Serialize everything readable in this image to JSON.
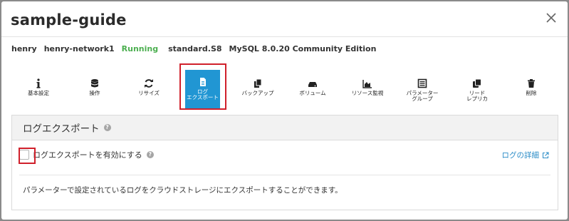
{
  "dialog": {
    "title": "sample-guide"
  },
  "info": {
    "user": "henry",
    "network": "henry-network1",
    "status": "Running",
    "plan": "standard.S8",
    "engine": "MySQL 8.0.20 Community Edition",
    "status_color": "#4caf50"
  },
  "toolbar": {
    "items": [
      {
        "label": "基本設定",
        "icon": "info-icon"
      },
      {
        "label": "操作",
        "icon": "database-icon"
      },
      {
        "label": "リサイズ",
        "icon": "sync-icon"
      },
      {
        "label": "ログ\nエクスポート",
        "icon": "file-icon",
        "active": true
      },
      {
        "label": "バックアップ",
        "icon": "copy-icon"
      },
      {
        "label": "ボリューム",
        "icon": "drive-icon"
      },
      {
        "label": "リソース監視",
        "icon": "area-chart-icon"
      },
      {
        "label": "パラメーター\nグループ",
        "icon": "list-icon"
      },
      {
        "label": "リード\nレプリカ",
        "icon": "clone-icon"
      },
      {
        "label": "削除",
        "icon": "trash-icon"
      }
    ],
    "active_color": "#2196d3",
    "highlight_color": "#d0202b"
  },
  "panel": {
    "title": "ログエクスポート",
    "help": "?",
    "enable_label": "ログエクスポートを有効にする",
    "enable_checked": false,
    "detail_link": "ログの詳細",
    "description": "パラメーターで設定されているログをクラウドストレージにエクスポートすることができます。"
  }
}
